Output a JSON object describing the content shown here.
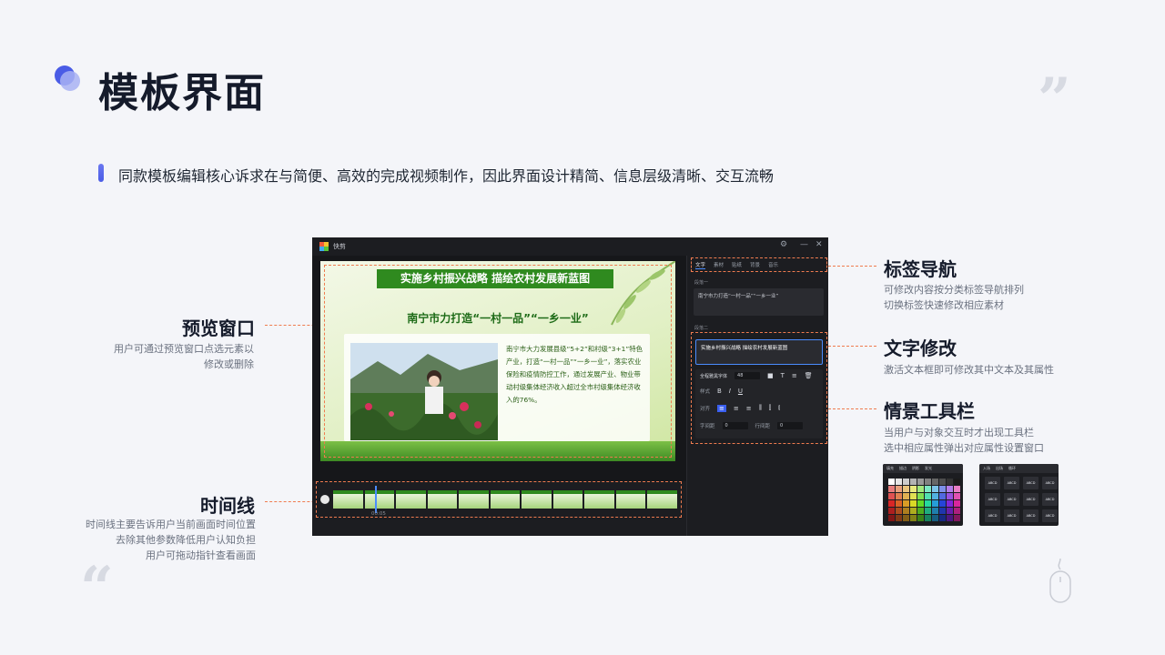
{
  "page": {
    "title": "模板界面",
    "subtitle": "同款模板编辑核心诉求在与简便、高效的完成视频制作，因此界面设计精简、信息层级清晰、交互流畅"
  },
  "annotations": {
    "preview": {
      "title": "预览窗口",
      "desc": [
        "用户可通过预览窗口点选元素以",
        "修改或删除"
      ]
    },
    "timeline": {
      "title": "时间线",
      "desc": [
        "时间线主要告诉用户当前画面时间位置",
        "去除其他参数降低用户认知负担",
        "用户可拖动指针查看画面"
      ]
    },
    "tabs": {
      "title": "标签导航",
      "desc": [
        "可修改内容按分类标签导航排列",
        "切换标签快速修改相应素材"
      ]
    },
    "text_edit": {
      "title": "文字修改",
      "desc": [
        "激活文本框即可修改其中文本及其属性"
      ]
    },
    "toolbar": {
      "title": "情景工具栏",
      "desc": [
        "当用户与对象交互时才出现工具栏",
        "选中相应属性弹出对应属性设置窗口"
      ]
    }
  },
  "app": {
    "name": "快剪",
    "window_controls": [
      "⚙",
      "—",
      "✕"
    ],
    "preview": {
      "headline": "实施乡村振兴战略  描绘农村发展新蓝图",
      "subhead": "南宁市力打造“一村一品”“一乡一业”",
      "body": "南宁市大力发展县级“5+2”和村级“3+1”特色产业，打造“一村一品”“一乡一业”，落实农业保险和疫情防控工作，通过发展产业、物业带动村级集体经济收入超过全市村级集体经济收入的76%。"
    },
    "timeline": {
      "time": "00:05"
    },
    "panel": {
      "tabs": [
        "文字",
        "素材",
        "贴纸",
        "背景",
        "音乐"
      ],
      "section1_label": "段落一",
      "section1_text": "南宁市力打造“一村一品”“一乡一业”",
      "section2_label": "段落二",
      "section2_text": "实施乡村振兴战略  描绘农村发展新蓝图",
      "font_name": "全程雅黑字体",
      "font_size": "48",
      "style_label": "样式",
      "style_buttons": [
        "B",
        "I",
        "U"
      ],
      "align_label": "对齐",
      "letter_spacing_label": "字间距",
      "letter_spacing_value": "0",
      "line_spacing_label": "行间距",
      "line_spacing_value": "0"
    }
  },
  "popover_colors": {
    "tabs": [
      "填充",
      "描边",
      "阴影",
      "发光"
    ]
  },
  "popover_styles": {
    "tabs": [
      "入场",
      "出场",
      "循环"
    ],
    "items": [
      "ABCD",
      "ABCD",
      "ABCD",
      "ABCD",
      "ABCD",
      "ABCD",
      "ABCD",
      "ABCD",
      "ABCD",
      "ABCD",
      "ABCD",
      "ABCD"
    ]
  },
  "colors": {
    "accent": "#ef7b4f",
    "brand_blue": "#4a5ce6",
    "highlight_blue": "#4a8cff",
    "headline_green": "#2f8a1f"
  }
}
